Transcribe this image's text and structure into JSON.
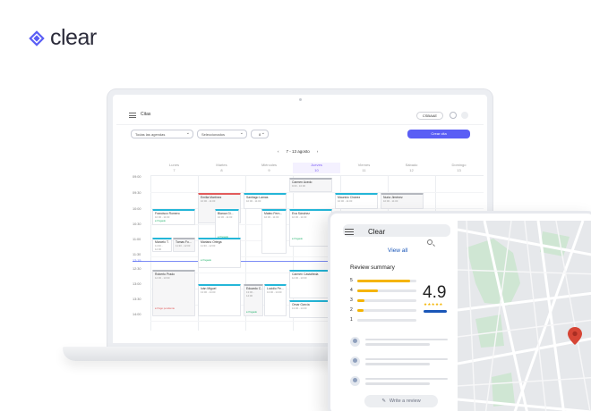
{
  "brand": {
    "name": "clear",
    "color": "#5a5ef5"
  },
  "calendar_app": {
    "title": "Citas",
    "user_chip": "CSBAAE",
    "filter_1": "Todas las agendas",
    "filter_2": "Seleccionados",
    "filter_3": "8",
    "new_button": "Crear cita",
    "week_label": "7 - 13 agosto",
    "days": [
      {
        "name": "Lunes",
        "num": "7"
      },
      {
        "name": "Martes",
        "num": "8"
      },
      {
        "name": "Miércoles",
        "num": "9"
      },
      {
        "name": "Jueves",
        "num": "10"
      },
      {
        "name": "Viernes",
        "num": "11"
      },
      {
        "name": "Sábado",
        "num": "12"
      },
      {
        "name": "Domingo",
        "num": "13"
      }
    ],
    "hours": [
      "09:00",
      "09:30",
      "10:00",
      "10:30",
      "11:00",
      "11:30",
      "12:15",
      "12:30",
      "13:00",
      "13:30",
      "14:00"
    ],
    "events": {
      "e1": {
        "title": "Francisco Romero",
        "sub": "10:00 - 11:00",
        "tag": "● Pagado"
      },
      "e2": {
        "title": "Emilia Martínez",
        "sub": "10:00 - 11:00"
      },
      "e3": {
        "title": "Blanca Gi...",
        "sub": "10:30 - 11:00",
        "tag": "● Pagado"
      },
      "e4": {
        "title": "Santiago Lamas",
        "sub": "10:00 - 11:00"
      },
      "e5": {
        "title": "Mateo Fern...",
        "sub": "10:30 - 11:00"
      },
      "e6": {
        "title": "Carmen Acedo",
        "sub": "9:00 - 10:00"
      },
      "e7": {
        "title": "Eva Sánchez",
        "sub": "10:30 - 11:00",
        "tag": "● Pagado"
      },
      "e8": {
        "title": "Mauricio Chávez",
        "sub": "10:00 - 11:00"
      },
      "e9": {
        "title": "Nuria Jiménez",
        "sub": "10:00 - 11:00"
      },
      "e10": {
        "title": "Marcelo T.",
        "sub": "11:30 - 12:00"
      },
      "e11": {
        "title": "Tomas Fo...",
        "sub": "11:30 - 12:00",
        "tag": "● Pagado"
      },
      "e12": {
        "title": "Mariano Ortega",
        "sub": "11:30 - 12:00",
        "tag": "● Pagado"
      },
      "e13": {
        "title": "Roberto Prado",
        "sub": "12:30 - 13:00",
        "tag": "● Pago pendiente"
      },
      "e14": {
        "title": "Iván Miguel",
        "sub": "13:00 - 14:00"
      },
      "e15": {
        "title": "Eduardo C...",
        "sub": "13:00 - 14:00",
        "tag": "● Pagado"
      },
      "e16": {
        "title": "Lucidio Pe...",
        "sub": "13:00 - 14:00"
      },
      "e17": {
        "title": "Carmen Castañeda",
        "sub": "12:30 - 13:00"
      },
      "e18": {
        "title": "Omar García",
        "sub": "13:30 - 14:00"
      }
    }
  },
  "mobile_app": {
    "search_text": "Clear",
    "view_all": "View all",
    "review_title": "Review summary",
    "ratings": [
      {
        "label": "5",
        "fill": 0.9
      },
      {
        "label": "4",
        "fill": 0.35
      },
      {
        "label": "3",
        "fill": 0.12
      },
      {
        "label": "2",
        "fill": 0.1
      },
      {
        "label": "1",
        "fill": 0.0
      }
    ],
    "score": "4.9",
    "stars": "★★★★★",
    "write_review": "Write a review",
    "star_color": "#f5b400",
    "link_color": "#1a56b8",
    "pin_color": "#d64535"
  }
}
